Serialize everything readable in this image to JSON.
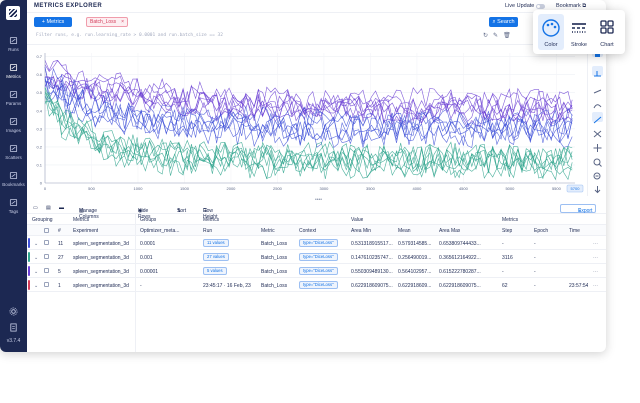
{
  "app": {
    "title": "METRICS EXPLORER",
    "live_update": "Live Update",
    "bookmark": "Bookmark",
    "version": "v3.7.4"
  },
  "sidebar": {
    "items": [
      {
        "label": "Runs",
        "icon": "runs-icon"
      },
      {
        "label": "Metrics",
        "icon": "metrics-icon",
        "active": true
      },
      {
        "label": "Params",
        "icon": "params-icon"
      },
      {
        "label": "Images",
        "icon": "images-icon"
      },
      {
        "label": "Scatters",
        "icon": "scatters-icon"
      },
      {
        "label": "Bookmarks",
        "icon": "bookmarks-icon"
      },
      {
        "label": "Tags",
        "icon": "tags-icon"
      }
    ]
  },
  "toolbar": {
    "metrics_button": "+ Metrics",
    "chip_label": "Batch_Loss",
    "chip_close": "×",
    "search_button": "Search"
  },
  "query": {
    "placeholder": "Filter runs, e.g. run.learning_rate > 0.0001 and run.batch_size == 32"
  },
  "popup": {
    "items": [
      {
        "label": "Color",
        "selected": true
      },
      {
        "label": "Stroke"
      },
      {
        "label": "Chart"
      }
    ]
  },
  "chart_data": {
    "type": "line",
    "x_ticks": [
      "0",
      "500",
      "1000",
      "1500",
      "2000",
      "2500",
      "3000",
      "3500",
      "4000",
      "4500",
      "5000",
      "5500"
    ],
    "y_ticks": [
      "0",
      "0.1",
      "0.2",
      "0.3",
      "0.4",
      "0.5",
      "0.6",
      "0.7"
    ],
    "xlim": [
      0,
      5700
    ],
    "ylim": [
      0,
      0.72
    ],
    "x_value_label": "5700",
    "series": [
      {
        "color": "#6b3fd4",
        "start": 0.62,
        "end": 0.42,
        "decay": 900,
        "noise": 0.07,
        "count": 7
      },
      {
        "color": "#3f51d8",
        "start": 0.55,
        "end": 0.3,
        "decay": 700,
        "noise": 0.08,
        "count": 6
      },
      {
        "color": "#2fa58d",
        "start": 0.45,
        "end": 0.12,
        "decay": 500,
        "noise": 0.08,
        "count": 7
      }
    ]
  },
  "table_toolbar": {
    "manage_columns": "Manage Columns",
    "hide_rows": "Hide Rows",
    "sort": "Sort",
    "row_height": "Row Height",
    "export": "Export"
  },
  "table": {
    "groups_header": [
      "Grouping",
      "Metrics",
      "Groups",
      "Metrics",
      "Value",
      "Metrics"
    ],
    "columns": [
      "#",
      "Experiment",
      "Optimizer_meta...",
      "Run",
      "Metric",
      "Context",
      "Area Min",
      "Mean",
      "Area Max",
      "Step",
      "Epoch",
      "Time"
    ],
    "rows": [
      {
        "color": "#3f51d8",
        "count": "11",
        "experiment": "spleen_segmentation_3d",
        "optimizer": "0.0001",
        "run": "11 values",
        "metric": "Batch_Loss",
        "context": "type=\"DiceLoss\"",
        "area_min": "0.531318915517...",
        "mean": "0.579314585...",
        "area_max": "0.653809744433...",
        "step": "-",
        "epoch": "-",
        "time": ""
      },
      {
        "color": "#2fa58d",
        "count": "27",
        "experiment": "spleen_segmentation_3d",
        "optimizer": "0.001",
        "run": "27 values",
        "metric": "Batch_Loss",
        "context": "type=\"DiceLoss\"",
        "area_min": "0.147610235747...",
        "mean": "0.256490019...",
        "area_max": "0.365612164922...",
        "step": "3116",
        "epoch": "-",
        "time": ""
      },
      {
        "color": "#6b3fd4",
        "count": "5",
        "experiment": "spleen_segmentation_3d",
        "optimizer": "0.00001",
        "run": "5 values",
        "metric": "Batch_Loss",
        "context": "type=\"DiceLoss\"",
        "area_min": "0.550309489130...",
        "mean": "0.564102957...",
        "area_max": "0.615222780287...",
        "step": "-",
        "epoch": "-",
        "time": ""
      },
      {
        "color": "#d33c5a",
        "count": "1",
        "experiment": "spleen_segmentation_3d",
        "optimizer": "-",
        "run": "23:45:17 · 16 Feb, 23",
        "metric": "Batch_Loss",
        "context": "type=\"DiceLoss\"",
        "area_min": "0.622918609075...",
        "mean": "0.622918609...",
        "area_max": "0.622918609075...",
        "step": "62",
        "epoch": "-",
        "time": "23:57:54"
      }
    ]
  }
}
